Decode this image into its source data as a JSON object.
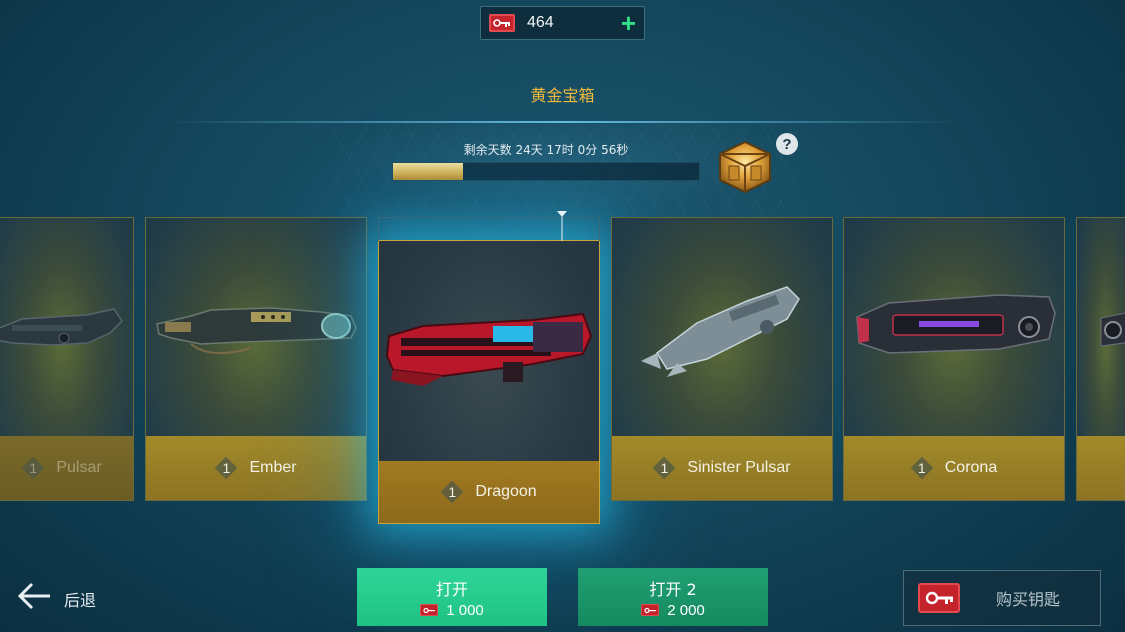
{
  "header": {
    "key_count": "464",
    "add_label": "+",
    "chest_title": "黄金宝箱",
    "timer_text": "剩余天数 24天 17时 0分 56秒",
    "progress_fraction": 0.23,
    "help_label": "?"
  },
  "cards": [
    {
      "level": "1",
      "name": "Pulsar",
      "state": "dim"
    },
    {
      "level": "1",
      "name": "Ember",
      "state": "normal"
    },
    {
      "level": "1",
      "name": "Dragoon",
      "state": "selected"
    },
    {
      "level": "1",
      "name": "Sinister Pulsar",
      "state": "normal"
    },
    {
      "level": "1",
      "name": "Corona",
      "state": "normal"
    }
  ],
  "footer": {
    "back_label": "后退",
    "open_one": {
      "label": "打开",
      "cost": "1 000"
    },
    "open_two": {
      "label": "打开 2",
      "cost": "2 000"
    },
    "buy_keys_label": "购买钥匙"
  },
  "colors": {
    "accent_green": "#2fe08a",
    "gold_title": "#f0b93a",
    "key_red": "#c4232c"
  },
  "icons": [
    "key-ticket-icon",
    "plus-icon",
    "chest-icon",
    "help-icon",
    "back-arrow-icon",
    "weapon-icon"
  ]
}
